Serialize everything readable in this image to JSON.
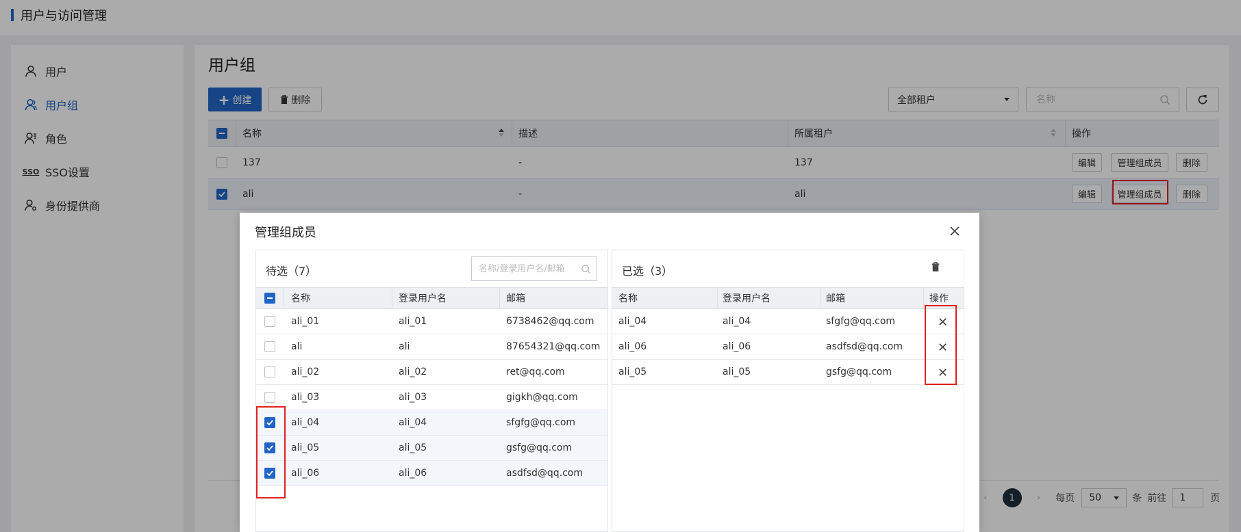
{
  "header": {
    "title": "用户与访问管理"
  },
  "sidebar": {
    "items": [
      {
        "label": "用户",
        "icon": "user-icon"
      },
      {
        "label": "用户组",
        "icon": "user-group-icon",
        "active": true
      },
      {
        "label": "角色",
        "icon": "role-icon"
      },
      {
        "label": "SSO设置",
        "icon": "sso-icon",
        "icon_text": "SSO"
      },
      {
        "label": "身份提供商",
        "icon": "identity-provider-icon"
      }
    ]
  },
  "main": {
    "title": "用户组",
    "toolbar": {
      "create_label": "创建",
      "delete_label": "删除",
      "tenant_select_value": "全部租户",
      "search_placeholder": "名称"
    },
    "table": {
      "columns": [
        "名称",
        "描述",
        "所属租户",
        "操作"
      ],
      "rows": [
        {
          "name": "137",
          "desc": "-",
          "tenant": "137",
          "checked": false
        },
        {
          "name": "ali",
          "desc": "-",
          "tenant": "ali",
          "checked": true
        }
      ],
      "actions": {
        "edit": "编辑",
        "manage": "管理组成员",
        "delete": "删除"
      }
    },
    "pagination": {
      "current_page": "1",
      "per_page_prefix": "每页",
      "page_size": "50",
      "per_page_suffix": "条",
      "goto_prefix": "前往",
      "goto_value": "1",
      "goto_suffix": "页"
    }
  },
  "dialog": {
    "title": "管理组成员",
    "left_panel": {
      "title": "待选（7）",
      "search_placeholder": "名称/登录用户名/邮箱",
      "columns": [
        "名称",
        "登录用户名",
        "邮箱"
      ],
      "rows": [
        {
          "name": "ali_01",
          "login": "ali_01",
          "email": "6738462@qq.com",
          "checked": false
        },
        {
          "name": "ali",
          "login": "ali",
          "email": "87654321@qq.com",
          "checked": false
        },
        {
          "name": "ali_02",
          "login": "ali_02",
          "email": "ret@qq.com",
          "checked": false
        },
        {
          "name": "ali_03",
          "login": "ali_03",
          "email": "gigkh@qq.com",
          "checked": false
        },
        {
          "name": "ali_04",
          "login": "ali_04",
          "email": "sfgfg@qq.com",
          "checked": true
        },
        {
          "name": "ali_05",
          "login": "ali_05",
          "email": "gsfg@qq.com",
          "checked": true
        },
        {
          "name": "ali_06",
          "login": "ali_06",
          "email": "asdfsd@qq.com",
          "checked": true
        }
      ]
    },
    "right_panel": {
      "title": "已选（3）",
      "columns": [
        "名称",
        "登录用户名",
        "邮箱",
        "操作"
      ],
      "rows": [
        {
          "name": "ali_04",
          "login": "ali_04",
          "email": "sfgfg@qq.com"
        },
        {
          "name": "ali_06",
          "login": "ali_06",
          "email": "asdfsd@qq.com"
        },
        {
          "name": "ali_05",
          "login": "ali_05",
          "email": "gsfg@qq.com"
        }
      ]
    }
  },
  "colors": {
    "accent": "#2166c6",
    "highlight": "#e02020"
  }
}
